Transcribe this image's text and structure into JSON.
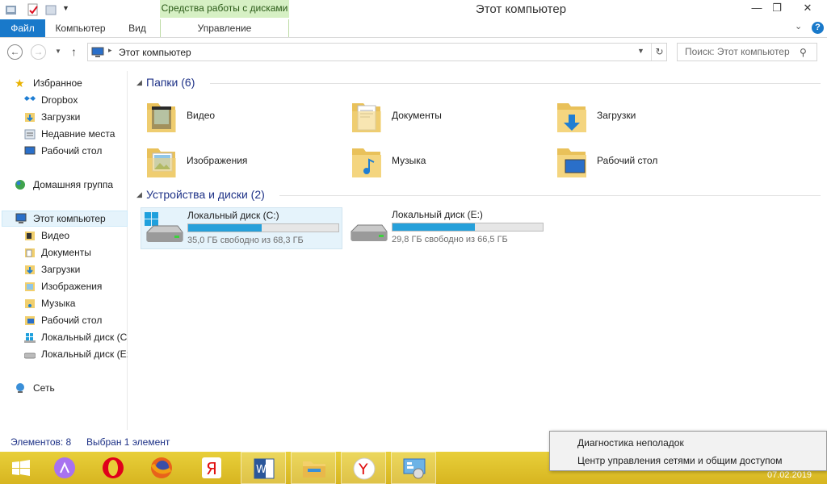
{
  "window": {
    "title": "Этот компьютер",
    "context_header": "Средства работы с дисками"
  },
  "ribbon": {
    "file_tab": "Файл",
    "tabs": [
      "Компьютер",
      "Вид"
    ],
    "context_tab": "Управление"
  },
  "address": {
    "path": "Этот компьютер",
    "search_placeholder": "Поиск: Этот компьютер"
  },
  "sidebar": {
    "favorites": {
      "label": "Избранное",
      "items": [
        "Dropbox",
        "Загрузки",
        "Недавние места",
        "Рабочий стол"
      ]
    },
    "homegroup": "Домашняя группа",
    "this_pc": {
      "label": "Этот компьютер",
      "items": [
        "Видео",
        "Документы",
        "Загрузки",
        "Изображения",
        "Музыка",
        "Рабочий стол",
        "Локальный диск (C",
        "Локальный диск (E:"
      ]
    },
    "network": "Сеть"
  },
  "main": {
    "folders_title": "Папки (6)",
    "folders": [
      "Видео",
      "Документы",
      "Загрузки",
      "Изображения",
      "Музыка",
      "Рабочий стол"
    ],
    "drives_title": "Устройства и диски (2)",
    "drives": [
      {
        "name": "Локальный диск (C:)",
        "free": "35,0 ГБ свободно из 68,3 ГБ",
        "used_fraction": 0.49
      },
      {
        "name": "Локальный диск (E:)",
        "free": "29,8 ГБ свободно из 66,5 ГБ",
        "used_fraction": 0.55
      }
    ]
  },
  "status": {
    "count": "Элементов: 8",
    "selected": "Выбран 1 элемент"
  },
  "popup": {
    "items": [
      "Диагностика неполадок",
      "Центр управления сетями и общим доступом"
    ]
  },
  "tray": {
    "date": "07.02.2019"
  },
  "colors": {
    "accent": "#1979ca",
    "taskbar": "#e2c82e",
    "drive_bar": "#26a0da"
  }
}
